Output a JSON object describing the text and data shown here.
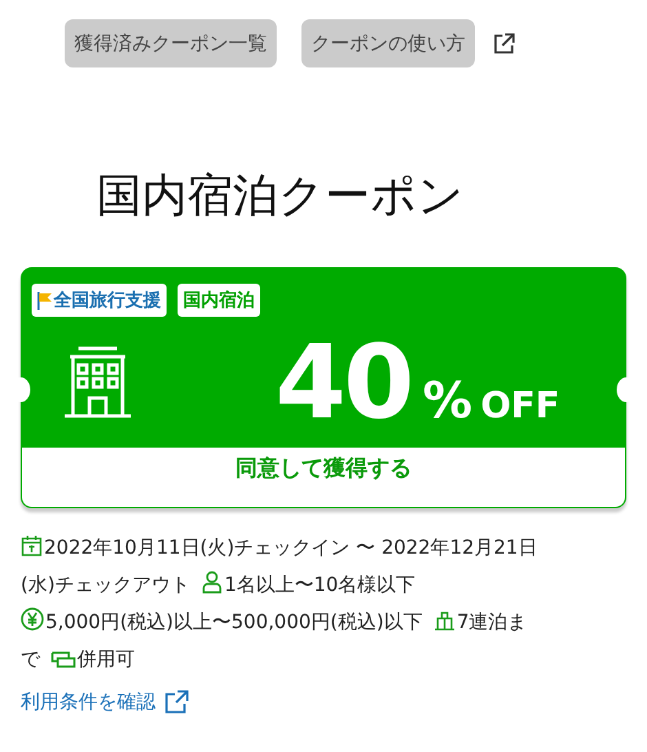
{
  "nav_buttons": [
    {
      "label": "獲得済みクーポン一覧",
      "external": false
    },
    {
      "label": "クーポンの使い方",
      "external": true
    }
  ],
  "title": "国内宿泊クーポン",
  "coupon": {
    "tags": [
      {
        "label": "全国旅行支援",
        "kind": "flag"
      },
      {
        "label": "国内宿泊",
        "kind": "plain"
      }
    ],
    "discount": "40",
    "unit": "%",
    "suffix": "OFF",
    "action": "同意して獲得する"
  },
  "conditions": [
    {
      "kind": "calendar",
      "lines": [
        "2022年10月11日(火)チェックイン 〜 2022年12月21日",
        "(水)チェックアウト"
      ]
    },
    {
      "kind": "person",
      "lines": [
        "1名以上〜10名様以下"
      ]
    },
    {
      "kind": "yen",
      "lines": [
        "5,000円(税込)以上〜500,000円(税込)以下"
      ]
    },
    {
      "kind": "bag",
      "lines": [
        "7連泊ま",
        "で"
      ]
    },
    {
      "kind": "ticket",
      "lines": [
        "併用可"
      ]
    }
  ],
  "terms_link": "利用条件を確認"
}
